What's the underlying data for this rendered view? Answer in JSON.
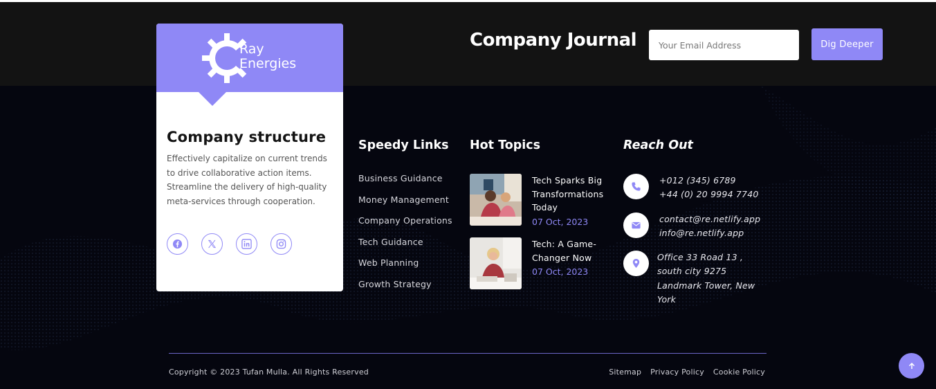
{
  "brand": {
    "name_line1": "Ray",
    "name_line2": "Energies",
    "color": "#8f88f6"
  },
  "journal": {
    "title": "Company Journal",
    "email_placeholder": "Your Email Address",
    "button_label": "Dig Deeper"
  },
  "card": {
    "title": "Company structure",
    "description": "Effectively capitalize on current trends to drive collaborative action items. Streamline the delivery of high-quality meta-services through cooperation.",
    "socials": [
      "facebook-icon",
      "x-twitter-icon",
      "linkedin-icon",
      "instagram-icon"
    ]
  },
  "speedy_links": {
    "title": "Speedy Links",
    "items": [
      "Business Guidance",
      "Money Management",
      "Company Operations",
      "Tech Guidance",
      "Web Planning",
      "Growth Strategy"
    ]
  },
  "hot_topics": {
    "title": "Hot Topics",
    "items": [
      {
        "title": "Tech Sparks Big Transformations Today",
        "date": "07 Oct, 2023"
      },
      {
        "title": "Tech: A Game-Changer Now",
        "date": "07 Oct, 2023"
      }
    ]
  },
  "reach_out": {
    "title": "Reach Out",
    "phone1": "+012 (345) 6789",
    "phone2": "+44 (0) 20 9994 7740",
    "email1": "contact@re.netlify.app",
    "email2": "info@re.netlify.app",
    "address_line1": "Office 33 Road 13 ,",
    "address_line2": "south city 9275",
    "address_line3": "Landmark Tower, New",
    "address_line4": "York"
  },
  "footer": {
    "copyright": "Copyright © 2023 Tufan Mulla. All Rights Reserved",
    "links": [
      "Sitemap",
      "Privacy Policy",
      "Cookie Policy"
    ]
  }
}
